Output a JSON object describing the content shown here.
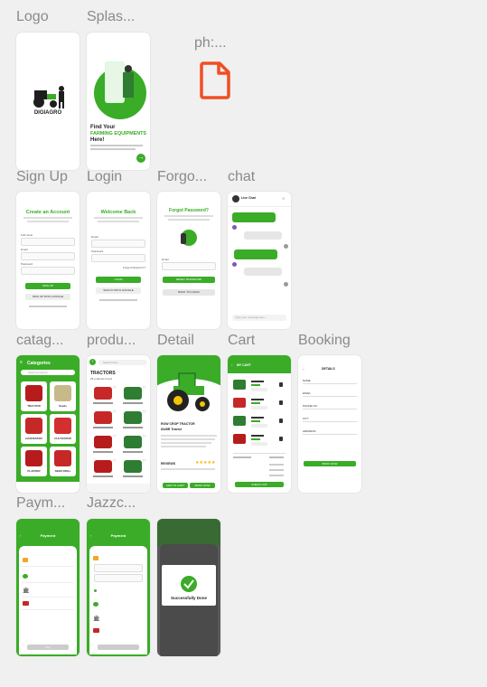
{
  "frames": [
    {
      "id": "logo",
      "label": "Logo"
    },
    {
      "id": "splash",
      "label": "Splas..."
    },
    {
      "id": "placeholder",
      "label": "ph:..."
    },
    {
      "id": "signup",
      "label": "Sign Up"
    },
    {
      "id": "login",
      "label": "Login"
    },
    {
      "id": "forgot",
      "label": "Forgo..."
    },
    {
      "id": "chat",
      "label": "chat"
    },
    {
      "id": "category",
      "label": "catag..."
    },
    {
      "id": "products",
      "label": "produ..."
    },
    {
      "id": "detail",
      "label": "Detail"
    },
    {
      "id": "cart",
      "label": "Cart"
    },
    {
      "id": "booking",
      "label": "Booking"
    },
    {
      "id": "payment",
      "label": "Paym..."
    },
    {
      "id": "jazzcash",
      "label": "Jazzc..."
    }
  ],
  "logo": {
    "brand": "DIGIAGRO"
  },
  "splash": {
    "title_line1": "Find Your",
    "title_line2": "FARMING EQUIPMENTS",
    "title_line3": "Here!"
  },
  "signup": {
    "title": "Create an Account",
    "name_label": "Full name",
    "email_label": "Email",
    "password_label": "Password",
    "submit": "SIGN UP",
    "google": "SIGN UP WITH GOOGLE"
  },
  "login": {
    "title": "Welcome Back",
    "email_label": "Email",
    "password_label": "Password",
    "forgot": "Forget Password ?",
    "submit": "LOGIN",
    "google": "SIGN IN WITH GOOGLE"
  },
  "forgot": {
    "title": "Forgot Password?",
    "email_label": "Email",
    "reset": "RESET PASSWORD",
    "back": "BACK TO LOGIN"
  },
  "chat": {
    "header": "Live Chat",
    "input_placeholder": "Type your message here..."
  },
  "category": {
    "title": "Categories",
    "search": "Search products",
    "items": [
      "TRACTOR",
      "Seeds",
      "HARVESTER",
      "CULTIVATOR",
      "PLANTER",
      "SEED DRILL"
    ]
  },
  "products": {
    "search": "Search here",
    "title": "TRACTORS",
    "subtitle": "25 products found"
  },
  "detail": {
    "name": "ROW CROP TRACTOR",
    "model": "8345R Tractor",
    "reviews": "REVIEWS",
    "add": "ADD TO CART",
    "book": "BOOK NOW"
  },
  "cart": {
    "title": "MY CART",
    "checkout": "CHECK OUT"
  },
  "booking": {
    "title": "DETAILS",
    "fields": [
      "NAME",
      "EMAIL",
      "PHONE NO",
      "CITY",
      "ADDRESS"
    ],
    "submit": "BOOK NOW"
  },
  "payment": {
    "title": "Payment",
    "pay": "Pay"
  },
  "jazzcash": {
    "title": "Payment"
  },
  "success": {
    "text": "Successfully Done"
  }
}
